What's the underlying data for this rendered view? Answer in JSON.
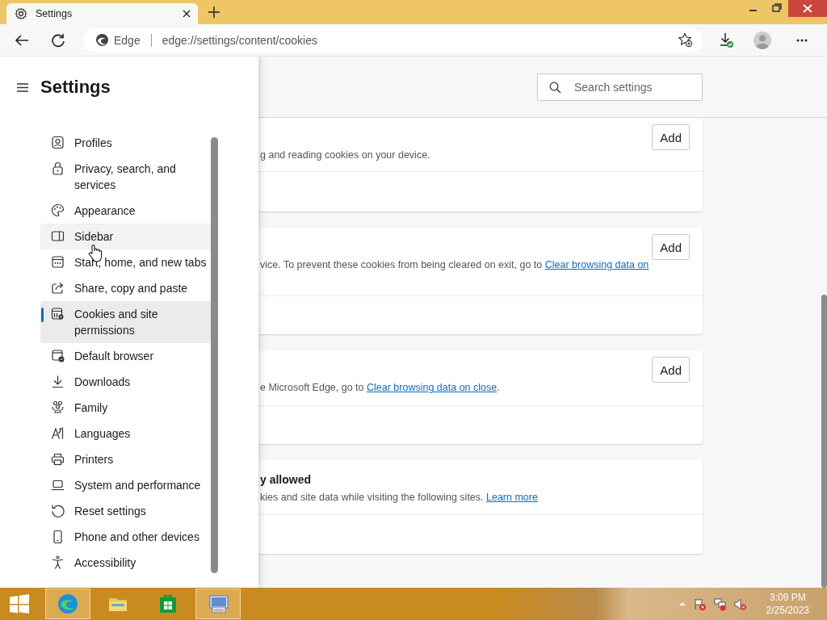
{
  "window": {
    "tab_title": "Settings"
  },
  "toolbar": {
    "address_label": "Edge",
    "url": "edge://settings/content/cookies"
  },
  "settings_nav": {
    "title": "Settings",
    "items": [
      {
        "label": "Profiles",
        "selected": false,
        "hovered": false
      },
      {
        "label": "Privacy, search, and services",
        "selected": false,
        "hovered": false
      },
      {
        "label": "Appearance",
        "selected": false,
        "hovered": false
      },
      {
        "label": "Sidebar",
        "selected": false,
        "hovered": true
      },
      {
        "label": "Start, home, and new tabs",
        "selected": false,
        "hovered": false
      },
      {
        "label": "Share, copy and paste",
        "selected": false,
        "hovered": false
      },
      {
        "label": "Cookies and site permissions",
        "selected": true,
        "hovered": false
      },
      {
        "label": "Default browser",
        "selected": false,
        "hovered": false
      },
      {
        "label": "Downloads",
        "selected": false,
        "hovered": false
      },
      {
        "label": "Family",
        "selected": false,
        "hovered": false
      },
      {
        "label": "Languages",
        "selected": false,
        "hovered": false
      },
      {
        "label": "Printers",
        "selected": false,
        "hovered": false
      },
      {
        "label": "System and performance",
        "selected": false,
        "hovered": false
      },
      {
        "label": "Reset settings",
        "selected": false,
        "hovered": false
      },
      {
        "label": "Phone and other devices",
        "selected": false,
        "hovered": false
      },
      {
        "label": "Accessibility",
        "selected": false,
        "hovered": false
      }
    ]
  },
  "search": {
    "placeholder": "Search settings"
  },
  "cards": [
    {
      "description": "g and reading cookies on your device.",
      "button": "Add"
    },
    {
      "description": "vice. To prevent these cookies from being cleared on exit, go to ",
      "link": "Clear browsing data on",
      "button": "Add"
    },
    {
      "description": "e Microsoft Edge, go to ",
      "link": "Clear browsing data on close",
      "after_link": ".",
      "button": "Add"
    },
    {
      "title": "y allowed",
      "description": "kies and site data while visiting the following sites. ",
      "link": "Learn more"
    }
  ],
  "taskbar": {
    "apps": [
      {
        "kind": "browser",
        "selected": true
      },
      {
        "kind": "files",
        "selected": false
      },
      {
        "kind": "store",
        "selected": false
      },
      {
        "kind": "remote",
        "selected": true
      }
    ],
    "time": "3:09 PM",
    "date": "2/25/2023"
  }
}
